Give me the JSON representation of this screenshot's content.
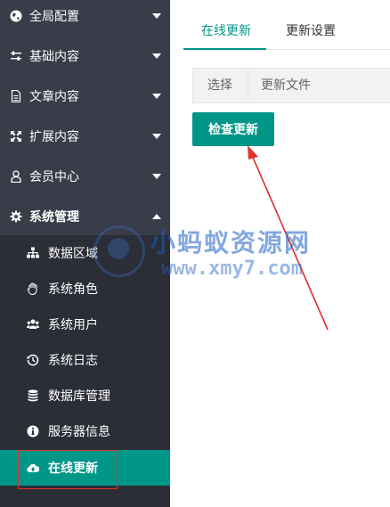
{
  "sidebar": {
    "items": [
      {
        "label": "全局配置",
        "icon": "globe-icon"
      },
      {
        "label": "基础内容",
        "icon": "sliders-icon"
      },
      {
        "label": "文章内容",
        "icon": "file-icon"
      },
      {
        "label": "扩展内容",
        "icon": "expand-icon"
      },
      {
        "label": "会员中心",
        "icon": "user-icon"
      },
      {
        "label": "系统管理",
        "icon": "gear-icon"
      }
    ],
    "sub_items": [
      {
        "label": "数据区域",
        "icon": "sitemap-icon"
      },
      {
        "label": "系统角色",
        "icon": "hand-icon"
      },
      {
        "label": "系统用户",
        "icon": "users-icon"
      },
      {
        "label": "系统日志",
        "icon": "history-icon"
      },
      {
        "label": "数据库管理",
        "icon": "database-icon"
      },
      {
        "label": "服务器信息",
        "icon": "info-icon"
      },
      {
        "label": "在线更新",
        "icon": "cloud-upload-icon"
      }
    ]
  },
  "tabs": [
    {
      "label": "在线更新",
      "active": true
    },
    {
      "label": "更新设置",
      "active": false
    }
  ],
  "table": {
    "headers": [
      "选择",
      "更新文件"
    ]
  },
  "check_button_label": "检查更新",
  "watermark": {
    "title": "小蚂蚁资源网",
    "url": "www.xmy7.com"
  },
  "colors": {
    "sidebar_bg": "#393d49",
    "submenu_bg": "#2b2e37",
    "accent": "#009688",
    "annotation_red": "#e0312b"
  }
}
